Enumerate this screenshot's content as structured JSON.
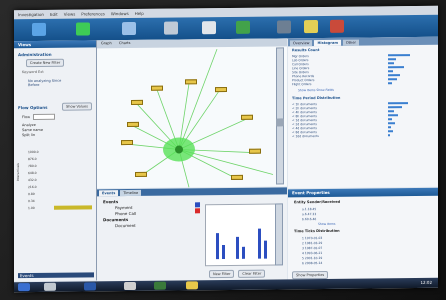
{
  "app": {
    "menu": [
      "Investigation",
      "Edit",
      "Views",
      "Preferences",
      "Windows",
      "Help"
    ],
    "colors": {
      "toolbar": "#1e5a96",
      "panel_header": "#2a6aa8",
      "accent_green": "#35c94a",
      "node_yellow": "#e7c64a",
      "bar_blue": "#3a7fd0"
    }
  },
  "left_panel": {
    "title": "Views",
    "section1": "Administration",
    "btn1": "Create New Filter",
    "item1": "Keyword Ext",
    "warning": "No analyzing Since Before",
    "section2": "Flow Options",
    "btn2": "Show Values",
    "flow_row": "Flow",
    "opt1": "Analyze",
    "opt2": "Same name",
    "opt3": "Split lin",
    "y_label": "Interarrivals",
    "tick_labels": [
      "1000.0",
      "876.0",
      "780.0",
      "648.0",
      "432.0",
      "216.0",
      "0.89",
      "0.34",
      "1.00"
    ],
    "footer": "Events"
  },
  "graph": {
    "tabs": [
      "Graph",
      "Charts"
    ],
    "node_labels": [
      "Node",
      "Node",
      "Node",
      "Node",
      "Node",
      "Node",
      "Node",
      "Node",
      "Node",
      "Node",
      "Node",
      "Node"
    ]
  },
  "right_panel": {
    "tabs": [
      "Overview",
      "Histogram",
      "Other"
    ],
    "group1_title": "Results Count",
    "group1_rows": [
      "Mgr Orders",
      "Lab Orders",
      "Call Orders",
      "Line Orders",
      "Site Orders",
      "Phone Records",
      "Product Orders",
      "Flight Orders"
    ],
    "link1": "Show Items",
    "link2": "Show Fields",
    "group2_title": "Time Period Distribution",
    "group2_rows": [
      "< 1h documents",
      "< 2h documents",
      "< 4h documents",
      "< 8h documents",
      "< 1d documents",
      "< 2d documents",
      "< 4d documents",
      "< 8d documents",
      "< 16d documents"
    ]
  },
  "event_properties": {
    "title": "Event Properties",
    "group1": "Entity Sender/Received",
    "rows1": [
      "a.1.18.45",
      "a.6.47.33",
      "b.60.6.46"
    ],
    "link": "Show Items",
    "group2": "Time Ticks Distribution",
    "rows2": [
      "1 1970-01-03",
      "2 1981-03-29",
      "3 1987-02-07",
      "4 1993-06-21",
      "5 2001-10-19",
      "6 2008-05-14"
    ],
    "footer_btn": "Show Properties"
  },
  "bottom_center": {
    "tabs": [
      "Events",
      "Timeline"
    ],
    "tree": [
      "Events",
      "Payment",
      "Phone Call",
      "Documents",
      "Document"
    ],
    "btn1": "New Filter",
    "btn2": "Clear Filter"
  },
  "taskbar": {
    "time": "12:02"
  }
}
